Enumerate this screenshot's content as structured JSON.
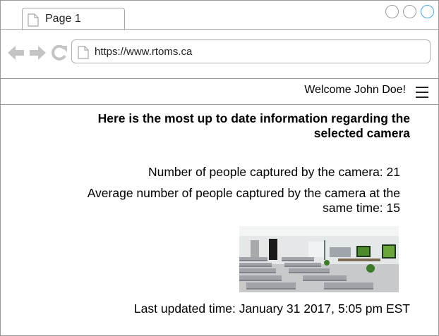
{
  "browser": {
    "tab_title": "Page 1",
    "url": "https://www.rtoms.ca",
    "icons": [
      "page-icon",
      "back-arrow-icon",
      "forward-arrow-icon",
      "reload-icon",
      "window-buttons"
    ]
  },
  "header": {
    "welcome_text": "Welcome John Doe!",
    "menu_icon": "hamburger-menu-icon"
  },
  "main": {
    "heading": "Here is the most up to date information regarding the selected camera",
    "people_captured": "Number of people captured by the camera: 21",
    "average_people": "Average number of people captured by the camera at the same time: 15",
    "last_updated": "Last updated time: January 31 2017, 5:05 pm EST"
  },
  "colors": {
    "border": "#9a9a9a",
    "window_button_active": "#4aa3df"
  }
}
